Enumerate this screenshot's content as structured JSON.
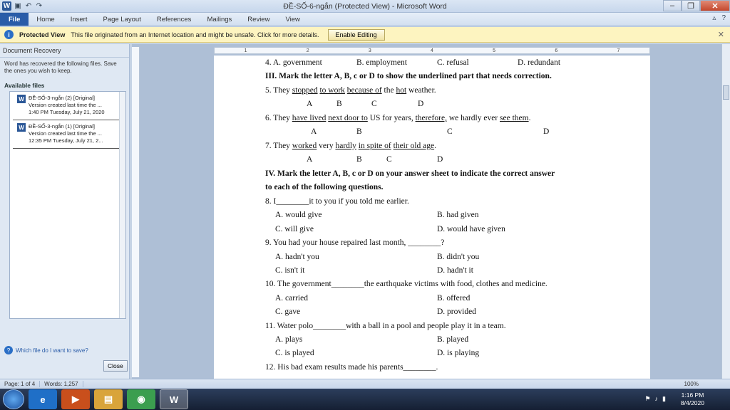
{
  "titlebar": {
    "title": "ĐỀ-SỐ-6-ngắn (Protected View) - Microsoft Word"
  },
  "ribbon": {
    "tabs": [
      "File",
      "Home",
      "Insert",
      "Page Layout",
      "References",
      "Mailings",
      "Review",
      "View"
    ]
  },
  "protected_view": {
    "label": "Protected View",
    "message": "This file originated from an Internet location and might be unsafe. Click for more details.",
    "button": "Enable Editing"
  },
  "recovery": {
    "header": "Document Recovery",
    "desc": "Word has recovered the following files.  Save the ones you wish to keep.",
    "available": "Available files",
    "files": [
      {
        "name": "ĐỀ-SỐ-3-ngắn (2)  [Original]",
        "line2": "Version created last time the ...",
        "line3": "1:40 PM Tuesday, July 21, 2020"
      },
      {
        "name": "ĐỀ-SỐ-3-ngắn (1)  [Original]",
        "line2": "Version created last time the ...",
        "line3": "12:35 PM Tuesday, July 21, 2..."
      }
    ],
    "help": "Which file do I want to save?",
    "close": "Close"
  },
  "ruler": {
    "ticks": [
      "1",
      "2",
      "3",
      "4",
      "5",
      "6",
      "7"
    ]
  },
  "doc": {
    "l1": {
      "a": "4. A. government",
      "b": "B. employment",
      "c": "C. refusal",
      "d": "D. redundant"
    },
    "sec3": "III. Mark the letter A, B, c or D to show the underlined part that needs correction.",
    "q5": {
      "n": "5. They ",
      "w1": "stopped",
      "w2": "to work",
      "w3": "because of",
      "w4": "the ",
      "w5": "hot",
      "w6": " weather."
    },
    "q5l": {
      "a": "A",
      "b": "B",
      "c": "C",
      "d": "D"
    },
    "q6": {
      "n": "6. They ",
      "w1": "have lived",
      "w2": "next door to",
      "w3": " US for years, ",
      "w4": "therefore,",
      "w5": " we hardly ever ",
      "w6": "see them",
      "w7": "."
    },
    "q6l": {
      "a": "A",
      "b": "B",
      "c": "C",
      "d": "D"
    },
    "q7": {
      "n": "7. They ",
      "w1": "worked",
      "w2": " very ",
      "w3": "hardly",
      "w4": "in spite of",
      "w5": "their old age",
      "w6": "."
    },
    "q7l": {
      "a": "A",
      "b": "B",
      "c": "C",
      "d": "D"
    },
    "sec4a": "IV. Mark the letter A, B, c or D on your answer sheet to indicate the correct answer",
    "sec4b": "to each of the following questions.",
    "q8": "8. I________it to you if you told me earlier.",
    "q8o": {
      "a": "A. would give",
      "b": "B. had given",
      "c": "C. will give",
      "d": "D. would have given"
    },
    "q9": "9. You had your house repaired last month, ________?",
    "q9o": {
      "a": "A. hadn't you",
      "b": "B. didn't you",
      "c": "C. isn't it",
      "d": "D. hadn't it"
    },
    "q10": "10. The government________the earthquake victims with food, clothes and medicine.",
    "q10o": {
      "a": "A. carried",
      "b": "B. offered",
      "c": "C. gave",
      "d": "D. provided"
    },
    "q11": "11. Water polo________with a ball in a pool and people play it in a team.",
    "q11o": {
      "a": "A. plays",
      "b": "B. played",
      "c": "C. is played",
      "d": "D. is playing"
    },
    "q12": "12. His bad exam results made his parents________."
  },
  "status": {
    "page": "Page: 1 of 4",
    "words": "Words: 1,257",
    "zoom": "100%"
  },
  "tray": {
    "time": "1:16 PM",
    "date": "8/4/2020"
  }
}
